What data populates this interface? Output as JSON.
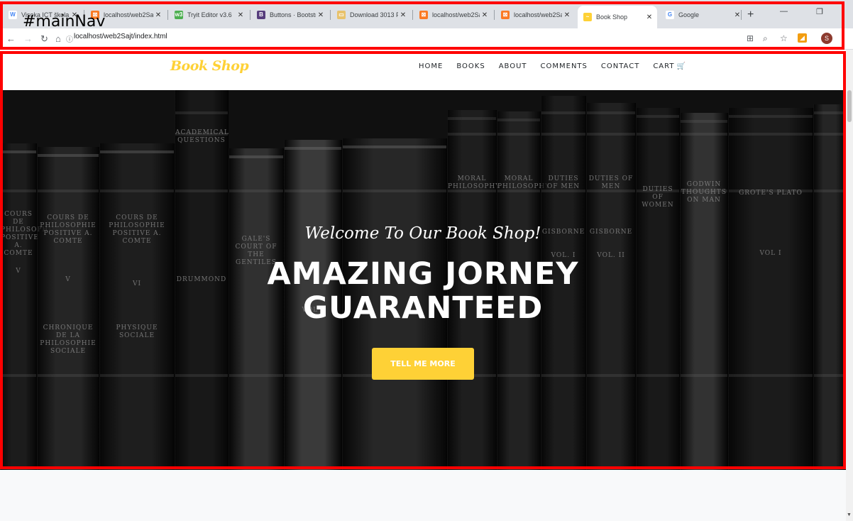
{
  "browser": {
    "tabs": [
      {
        "title": "Visoka ICT škola |",
        "favicon": "wp-icon",
        "favicon_color": "#ffffff",
        "favicon_text": "W"
      },
      {
        "title": "localhost/web2Saj",
        "favicon": "xampp-icon",
        "favicon_color": "#fb7a24",
        "favicon_text": "⊠"
      },
      {
        "title": "Tryit Editor v3.6",
        "favicon": "w3schools-icon",
        "favicon_color": "#4caf50",
        "favicon_text": "w3"
      },
      {
        "title": "Buttons · Bootstra",
        "favicon": "bootstrap-icon",
        "favicon_color": "#563d7c",
        "favicon_text": "B"
      },
      {
        "title": "Download 3013 Fr",
        "favicon": "download-icon",
        "favicon_color": "#e8c26b",
        "favicon_text": "▭"
      },
      {
        "title": "localhost/web2Saj",
        "favicon": "xampp-icon",
        "favicon_color": "#fb7a24",
        "favicon_text": "⊠"
      },
      {
        "title": "localhost/web2Saj",
        "favicon": "xampp-icon",
        "favicon_color": "#fb7a24",
        "favicon_text": "⊠"
      },
      {
        "title": "Book Shop",
        "favicon": "bookshop-icon",
        "favicon_color": "#fed136",
        "favicon_text": "~",
        "active": true
      },
      {
        "title": "Google",
        "favicon": "google-icon",
        "favicon_color": "#ffffff",
        "favicon_text": "G"
      }
    ],
    "address": "localhost/web2Sajt/index.html",
    "profile_initial": "S"
  },
  "annotation": {
    "label": "#mainNav"
  },
  "site": {
    "brand": "Book Shop",
    "nav": [
      "HOME",
      "BOOKS",
      "ABOUT",
      "COMMENTS",
      "CONTACT",
      "CART"
    ],
    "hero": {
      "welcome": "Welcome To Our Book Shop!",
      "headline_line1": "AMAZING JORNEY",
      "headline_line2": "GUARANTEED",
      "cta": "TELL ME MORE"
    },
    "spines": [
      "COURS DE PHILOSOPHIE POSITIVE A. COMTE",
      "V",
      "CHRONIQUE DE LA PHILOSOPHIE SOCIALE",
      "COURS DE PHILOSOPHIE POSITIVE A. COMTE",
      "VI",
      "PHYSIQUE SOCIALE",
      "ACADEMICAL QUESTIONS",
      "DRUMMOND",
      "GALE'S COURT OF THE GENTILES",
      "VOL I",
      "MORAL PHILOSOPHY",
      "DUTIES OF MEN",
      "GISBORNE",
      "VOL. I",
      "VOL. II",
      "DUTIES OF WOMEN",
      "GODWIN THOUGHTS ON MAN",
      "GROTE'S PLATO",
      "VOL I"
    ]
  },
  "colors": {
    "accent": "#fed136",
    "annotation": "#ff0000"
  }
}
